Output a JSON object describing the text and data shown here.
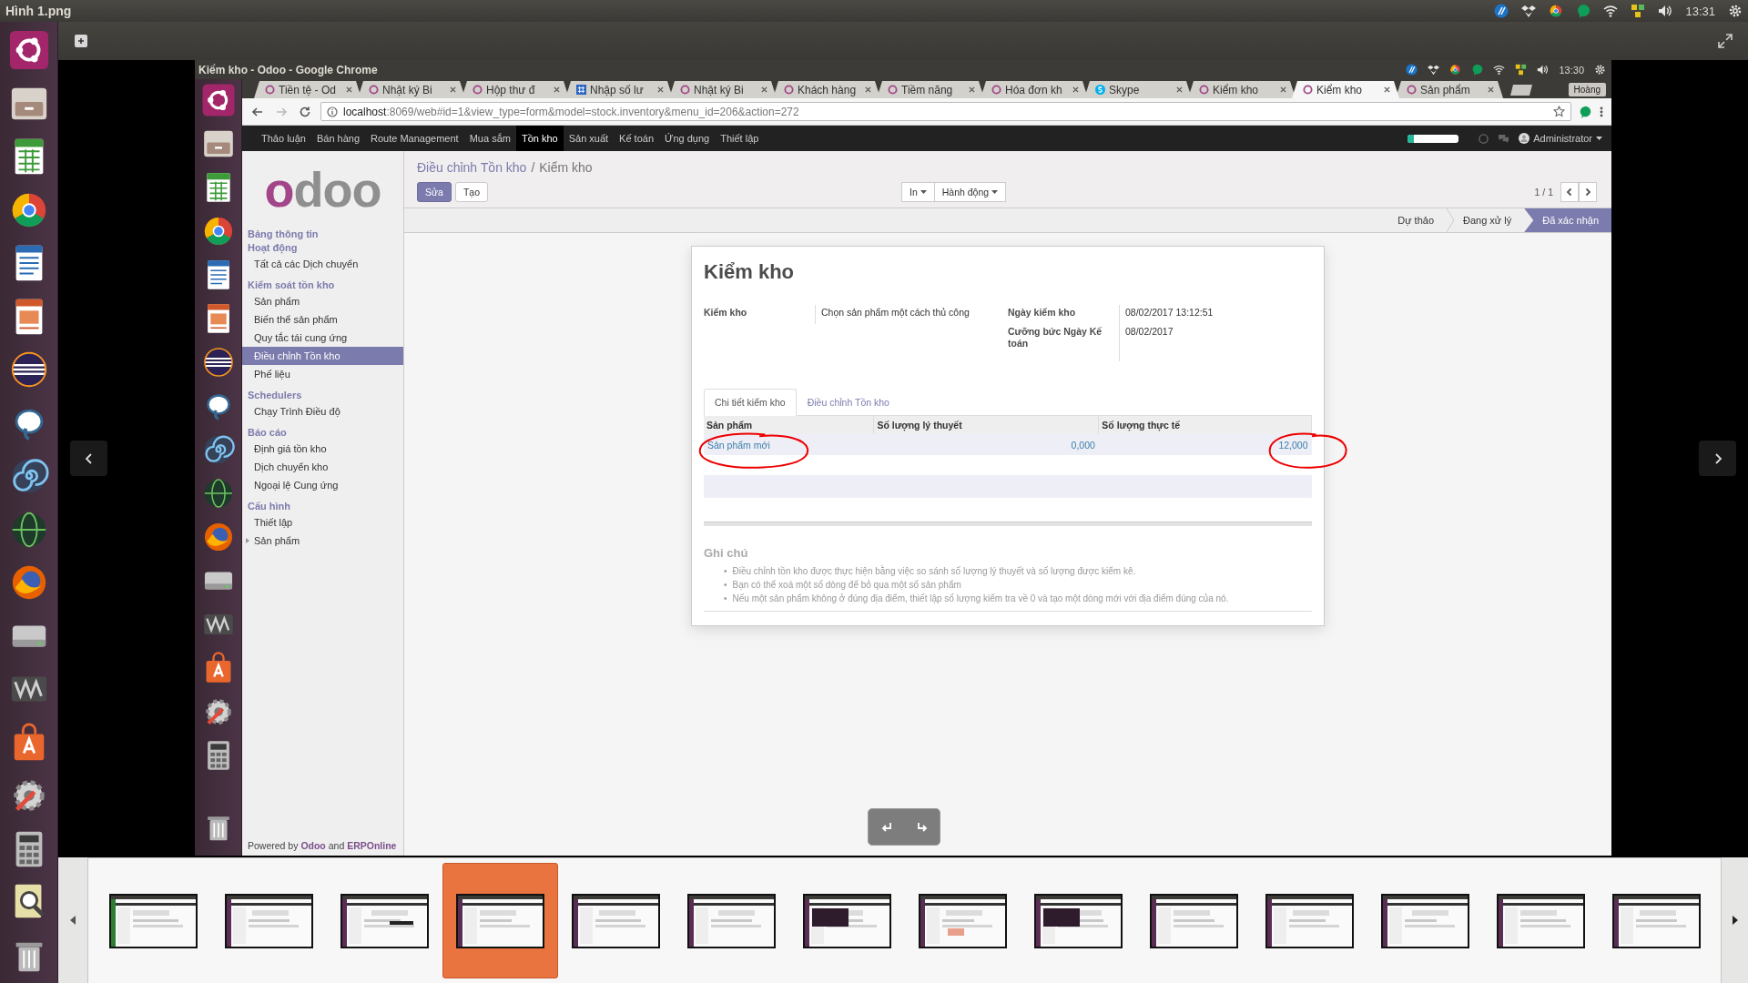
{
  "viewer": {
    "title": "Hình 1.png",
    "clock": "13:31"
  },
  "browser": {
    "title": "Kiểm kho - Odoo - Google Chrome",
    "clock": "13:30",
    "profile": "Hoàng",
    "tabs": [
      {
        "label": "Tiền tệ - Od",
        "kind": "odoo",
        "selected": false
      },
      {
        "label": "Nhật ký Bi",
        "kind": "odoo",
        "selected": false
      },
      {
        "label": "Hộp thư đ",
        "kind": "odoo",
        "selected": false
      },
      {
        "label": "Nhập số lư",
        "kind": "sheet",
        "selected": false
      },
      {
        "label": "Nhật ký Bi",
        "kind": "odoo",
        "selected": false
      },
      {
        "label": "Khách hàng",
        "kind": "odoo",
        "selected": false
      },
      {
        "label": "Tiềm năng",
        "kind": "odoo",
        "selected": false
      },
      {
        "label": "Hóa đơn kh",
        "kind": "odoo",
        "selected": false
      },
      {
        "label": "Skype",
        "kind": "skype",
        "selected": false
      },
      {
        "label": "Kiểm kho",
        "kind": "odoo",
        "selected": false
      },
      {
        "label": "Kiểm kho",
        "kind": "odoo",
        "selected": true
      },
      {
        "label": "Sản phẩm",
        "kind": "odoo",
        "selected": false
      }
    ],
    "url": {
      "host": "localhost",
      "rest": ":8069/web#id=1&view_type=form&model=stock.inventory&menu_id=206&action=272"
    }
  },
  "odoo": {
    "menu": [
      {
        "label": "Thảo luận",
        "selected": false
      },
      {
        "label": "Bán hàng",
        "selected": false
      },
      {
        "label": "Route Management",
        "selected": false
      },
      {
        "label": "Mua sắm",
        "selected": false
      },
      {
        "label": "Tồn kho",
        "selected": true
      },
      {
        "label": "Sản xuất",
        "selected": false
      },
      {
        "label": "Kế toán",
        "selected": false
      },
      {
        "label": "Ứng dụng",
        "selected": false
      },
      {
        "label": "Thiết lập",
        "selected": false
      }
    ],
    "progress": {
      "level": 0.12
    },
    "user": "Administrator",
    "logo": {
      "accent": "o",
      "rest": "doo"
    },
    "sidebar": [
      {
        "title": "Bảng thông tin"
      },
      {
        "title": "Hoạt động",
        "items": [
          {
            "label": "Tất cả các Dịch chuyển",
            "selected": false,
            "expandable": false
          }
        ]
      },
      {
        "title": "Kiểm soát tồn kho",
        "items": [
          {
            "label": "Sản phẩm",
            "selected": false,
            "expandable": false
          },
          {
            "label": "Biến thể sản phẩm",
            "selected": false,
            "expandable": false
          },
          {
            "label": "Quy tắc tái cung ứng",
            "selected": false,
            "expandable": false
          },
          {
            "label": "Điều chỉnh Tồn kho",
            "selected": true,
            "expandable": false
          },
          {
            "label": "Phế liệu",
            "selected": false,
            "expandable": false
          }
        ]
      },
      {
        "title": "Schedulers",
        "items": [
          {
            "label": "Chạy Trình Điều độ",
            "selected": false,
            "expandable": false
          }
        ]
      },
      {
        "title": "Báo cáo",
        "items": [
          {
            "label": "Định giá tồn kho",
            "selected": false,
            "expandable": false
          },
          {
            "label": "Dịch chuyển kho",
            "selected": false,
            "expandable": false
          },
          {
            "label": "Ngoại lệ Cung ứng",
            "selected": false,
            "expandable": false
          }
        ]
      },
      {
        "title": "Cấu hình",
        "items": [
          {
            "label": "Thiết lập",
            "selected": false,
            "expandable": false
          },
          {
            "label": "Sản phẩm",
            "selected": false,
            "expandable": true
          }
        ]
      }
    ],
    "footer": "Powered by **Odoo** and **ERPOnline**",
    "breadcrumb": {
      "parent": "Điều chỉnh Tồn kho",
      "separator": "/",
      "current": "Kiểm kho"
    },
    "buttons": [
      {
        "label": "Sửa",
        "kind": "primary"
      },
      {
        "label": "Tạo",
        "kind": "secondary"
      }
    ],
    "dropdowns": [
      "In",
      "Hành động"
    ],
    "pager": "1 / 1",
    "stages": [
      {
        "label": "Dự thảo",
        "selected": false
      },
      {
        "label": "Đang xử lý",
        "selected": false
      },
      {
        "label": "Đã xác nhận",
        "selected": true
      }
    ],
    "form": {
      "title": "Kiểm kho",
      "fields_left": [
        {
          "label": "Kiểm kho",
          "value": "Chọn sản phẩm một cách thủ công"
        }
      ],
      "fields_right": [
        {
          "label": "Ngày kiểm kho",
          "value": "08/02/2017 13:12:51"
        },
        {
          "label": "Cưỡng bức Ngày Kế toán",
          "value": "08/02/2017"
        }
      ],
      "tabs": [
        {
          "label": "Chi tiết kiểm kho",
          "selected": true
        },
        {
          "label": "Điều chỉnh Tồn kho",
          "selected": false
        }
      ],
      "table": {
        "columns": [
          "Sản phẩm",
          "Số lượng lý thuyết",
          "Số lượng thực tế"
        ],
        "rows": [
          {
            "cells": [
              {
                "text": "Sản phẩm mới",
                "circled": true
              },
              {
                "text": "0,000",
                "circled": false
              },
              {
                "text": "12,000",
                "circled": true
              }
            ]
          }
        ]
      },
      "notes": {
        "title": "Ghi chú",
        "bullet": "•",
        "items": [
          "Điều chỉnh tồn kho được thực hiện bằng việc so sánh số lượng lý thuyết và số lượng được kiểm kê.",
          "Bạn có thể xoá một số dòng để bỏ qua một số sản phẩm",
          "Nếu một sản phẩm không ở đúng địa điểm, thiết lập số lượng kiểm tra về 0 và tạo một dòng mới với địa điểm đúng của nó."
        ]
      }
    }
  },
  "filmstrip": {
    "thumbnails": [
      {
        "selected": false
      },
      {
        "selected": false
      },
      {
        "selected": false
      },
      {
        "selected": true
      },
      {
        "selected": false
      },
      {
        "selected": false
      },
      {
        "selected": false
      },
      {
        "selected": false
      },
      {
        "selected": false
      },
      {
        "selected": false
      },
      {
        "selected": false
      },
      {
        "selected": false
      },
      {
        "selected": false
      },
      {
        "selected": false
      }
    ]
  }
}
